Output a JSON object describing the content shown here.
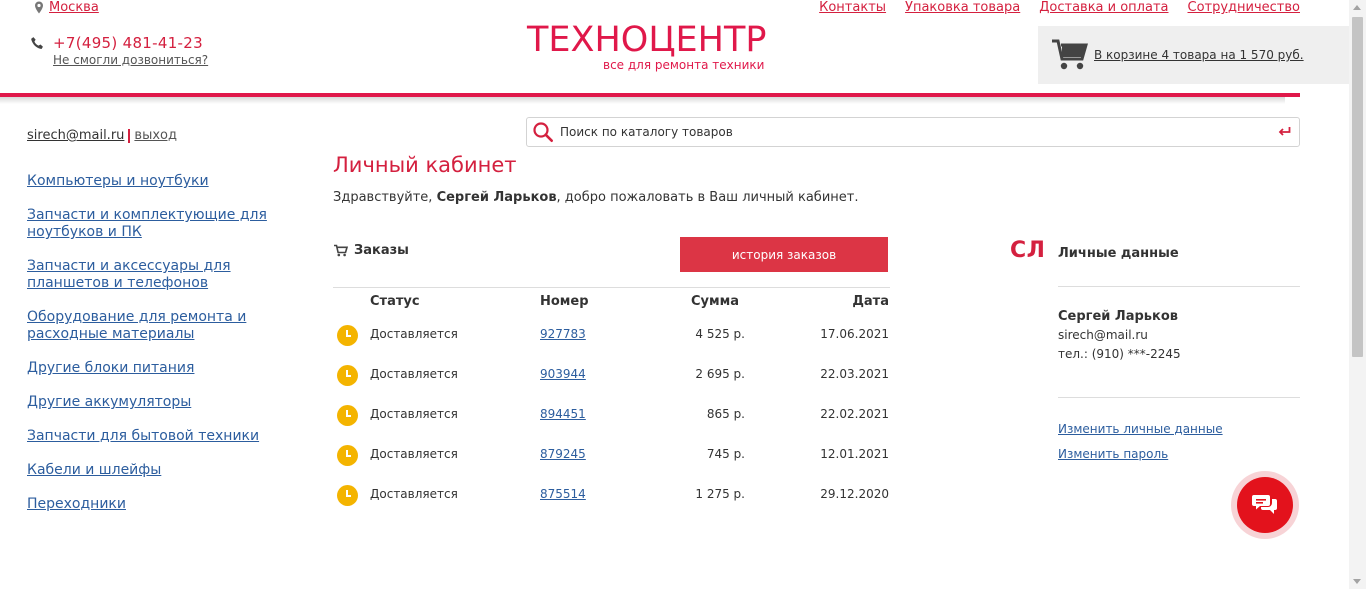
{
  "header": {
    "city": "Москва",
    "phone": "+7(495) 481-41-23",
    "callback": "Не смогли дозвониться?",
    "logo_main": "ТЕХНОЦЕНТР",
    "logo_sub": "все для ремонта техники",
    "top_links": [
      "Контакты",
      "Упаковка товара",
      "Доставка и оплата",
      "Сотрудничество"
    ],
    "cart_text": "В корзине 4 товара на 1 570 руб."
  },
  "sidebar": {
    "email": "sirech@mail.ru",
    "logout": "выход",
    "catalog": [
      "Компьютеры и ноутбуки",
      "Запчасти и комплектующие для ноутбуков и ПК",
      "Запчасти и аксессуары для планшетов и телефонов",
      "Оборудование для ремонта и расходные материалы",
      "Другие блоки питания",
      "Другие аккумуляторы",
      "Запчасти для бытовой техники",
      "Кабели и шлейфы",
      "Переходники"
    ]
  },
  "search": {
    "placeholder": "Поиск по каталогу товаров"
  },
  "main": {
    "title": "Личный кабинет",
    "greeting_prefix": "Здравствуйте, ",
    "greeting_name": "Сергей Ларьков",
    "greeting_suffix": ", добро пожаловать в Ваш личный кабинет.",
    "orders_title": "Заказы",
    "history_button": "история заказов",
    "columns": {
      "status": "Статус",
      "number": "Номер",
      "sum": "Сумма",
      "date": "Дата"
    },
    "orders": [
      {
        "status": "Доставляется",
        "number": "927783",
        "sum": "4 525 р.",
        "date": "17.06.2021"
      },
      {
        "status": "Доставляется",
        "number": "903944",
        "sum": "2 695 р.",
        "date": "22.03.2021"
      },
      {
        "status": "Доставляется",
        "number": "894451",
        "sum": "865 р.",
        "date": "22.02.2021"
      },
      {
        "status": "Доставляется",
        "number": "879245",
        "sum": "745 р.",
        "date": "12.01.2021"
      },
      {
        "status": "Доставляется",
        "number": "875514",
        "sum": "1 275 р.",
        "date": "29.12.2020"
      }
    ]
  },
  "personal": {
    "initials": "СЛ",
    "title": "Личные данные",
    "name": "Сергей Ларьков",
    "email": "sirech@mail.ru",
    "phone": "тел.: (910) ***-2245",
    "edit_link": "Изменить личные данные",
    "password_link": "Изменить пароль"
  },
  "colors": {
    "accent": "#e0184a",
    "link": "#2c5d9e",
    "button": "#dc3545",
    "status": "#f4b400",
    "chat": "#e3121c"
  },
  "icons": [
    "location-pin-icon",
    "phone-icon",
    "cart-icon",
    "search-icon",
    "enter-icon",
    "clock-icon",
    "chat-icon"
  ]
}
